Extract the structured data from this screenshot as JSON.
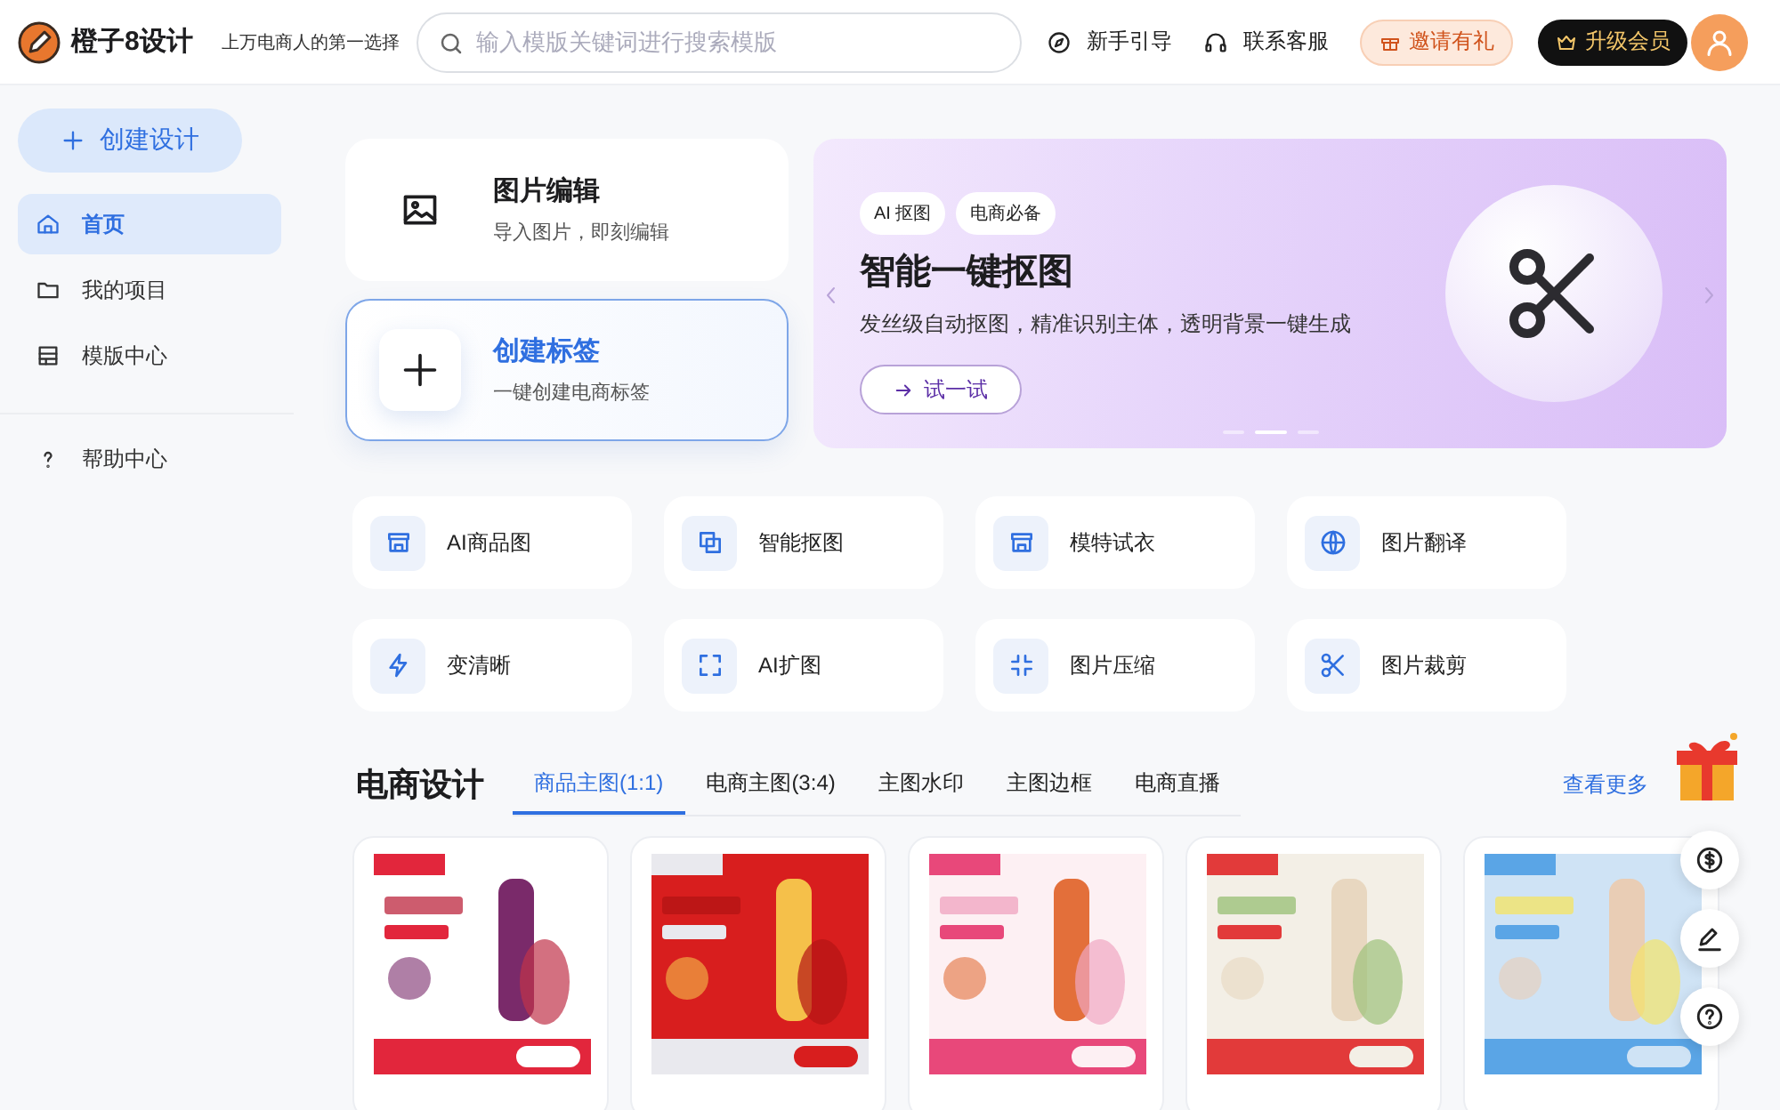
{
  "header": {
    "logo_text": "橙子8设计",
    "slogan": "上万电商人的第一选择",
    "search": {
      "placeholder": "输入模版关键词进行搜索模版"
    },
    "links": [
      "新手引导",
      "联系客服"
    ],
    "invite_button": "邀请有礼",
    "upgrade_button": "升级会员"
  },
  "sidebar": {
    "create_button": "创建设计",
    "items": [
      {
        "label": "首页",
        "selected": true
      },
      {
        "label": "我的项目",
        "selected": false
      },
      {
        "label": "模版中心",
        "selected": false
      }
    ],
    "footer_items": [
      {
        "label": "帮助中心",
        "selected": false
      }
    ]
  },
  "quick_cards": [
    {
      "title": "图片编辑",
      "subtitle": "导入图片，即刻编辑",
      "selected": false
    },
    {
      "title": "创建标签",
      "subtitle": "一键创建电商标签",
      "selected": true
    }
  ],
  "banner": {
    "tags": [
      "AI 抠图",
      "电商必备"
    ],
    "title": "智能一键抠图",
    "description": "发丝级自动抠图，精准识别主体，透明背景一键生成",
    "button": "试一试",
    "slides": [
      {
        "selected": false
      },
      {
        "selected": true
      },
      {
        "selected": false
      }
    ]
  },
  "tools": [
    {
      "label": "AI商品图"
    },
    {
      "label": "智能抠图"
    },
    {
      "label": "模特试衣"
    },
    {
      "label": "图片翻译"
    },
    {
      "label": "变清晰"
    },
    {
      "label": "AI扩图"
    },
    {
      "label": "图片压缩"
    },
    {
      "label": "图片裁剪"
    }
  ],
  "design_section": {
    "title": "电商设计",
    "tabs": [
      {
        "label": "商品主图(1:1)",
        "selected": true
      },
      {
        "label": "电商主图(3:4)",
        "selected": false
      },
      {
        "label": "主图水印",
        "selected": false
      },
      {
        "label": "主图边框",
        "selected": false
      },
      {
        "label": "电商直播",
        "selected": false
      }
    ],
    "more_link": "查看更多"
  }
}
